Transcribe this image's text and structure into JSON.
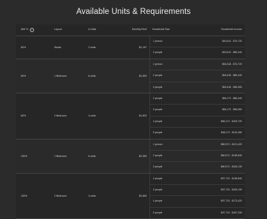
{
  "title": "Available Units & Requirements",
  "headers": {
    "ami": "AMI %",
    "layout": "Layout",
    "units": "# Units",
    "rent": "Monthly Rent",
    "household_size": "Household Size",
    "household_income": "Household Income"
  },
  "icons": {
    "info": "info-icon"
  },
  "groups": [
    {
      "ami": "60%",
      "layout": "Studio",
      "units": "2 units",
      "rent": "$1,197",
      "rows": [
        {
          "size": "1 person",
          "income": "$43,612 - $74,720"
        },
        {
          "size": "2 people",
          "income": "$43,612 - $85,440"
        }
      ]
    },
    {
      "ami": "60%",
      "layout": "1 Bedroom",
      "units": "8 units",
      "rent": "$1,509",
      "rows": [
        {
          "size": "1 person",
          "income": "$54,618 - $74,720"
        },
        {
          "size": "2 people",
          "income": "$54,618 - $85,440"
        },
        {
          "size": "3 people",
          "income": "$54,618 - $96,060"
        }
      ]
    },
    {
      "ami": "60%",
      "layout": "2 Bedroom",
      "units": "4 units",
      "rent": "$1,820",
      "rows": [
        {
          "size": "2 people",
          "income": "$66,172 - $85,440"
        },
        {
          "size": "3 people",
          "income": "$66,172 - $96,060"
        },
        {
          "size": "4 people",
          "income": "$66,172 - $106,720"
        },
        {
          "size": "5 people",
          "income": "$66,172 - $115,280"
        }
      ]
    },
    {
      "ami": "130%",
      "layout": "1 Bedroom",
      "units": "6 units",
      "rent": "$2,350",
      "rows": [
        {
          "size": "1 person",
          "income": "$80,572 - $121,420"
        },
        {
          "size": "2 people",
          "income": "$80,572 - $138,840"
        },
        {
          "size": "3 people",
          "income": "$80,572 - $156,130"
        }
      ]
    },
    {
      "ami": "130%",
      "layout": "2 Bedroom",
      "units": "3 units",
      "rent": "$2,850",
      "rows": [
        {
          "size": "2 people",
          "income": "$97,715 - $138,840"
        },
        {
          "size": "3 people",
          "income": "$97,715 - $156,130"
        },
        {
          "size": "4 people",
          "income": "$97,715 - $173,420"
        },
        {
          "size": "5 people",
          "income": "$97,715 - $187,330"
        }
      ]
    }
  ]
}
